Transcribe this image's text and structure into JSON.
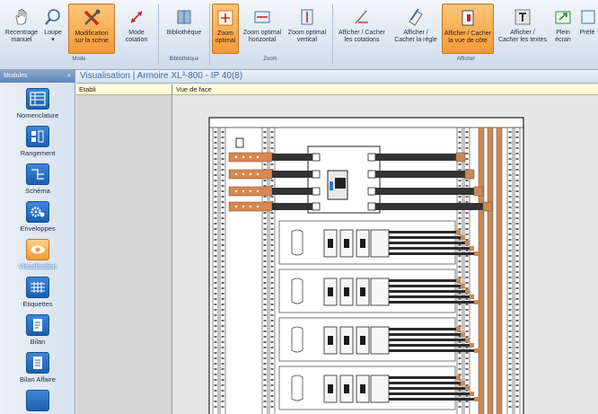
{
  "ribbon": {
    "buttons": [
      {
        "label1": "Recentrage",
        "label2": "manuel",
        "icon": "hand-icon",
        "active": false
      },
      {
        "label1": "Loupe",
        "label2": "▾",
        "icon": "magnifier-icon",
        "active": false
      },
      {
        "label1": "Modification",
        "label2": "sur la scène",
        "icon": "tools-icon",
        "active": true
      },
      {
        "label1": "Mode",
        "label2": "cotation",
        "icon": "dimension-icon",
        "active": false
      },
      {
        "label1": "Bibliothèque",
        "label2": "",
        "icon": "library-icon",
        "active": false
      },
      {
        "label1": "Zoom",
        "label2": "optimal",
        "icon": "zoom-optimal-icon",
        "active": true
      },
      {
        "label1": "Zoom optimal",
        "label2": "horizontal",
        "icon": "zoom-horizontal-icon",
        "active": false
      },
      {
        "label1": "Zoom optimal",
        "label2": "vertical",
        "icon": "zoom-vertical-icon",
        "active": false
      },
      {
        "label1": "Afficher / Cacher",
        "label2": "les cotations",
        "icon": "ruler-icon",
        "active": false
      },
      {
        "label1": "Afficher /",
        "label2": "Cacher la règle",
        "icon": "rule-icon",
        "active": false
      },
      {
        "label1": "Afficher / Cacher",
        "label2": "la vue de côté",
        "icon": "side-view-icon",
        "active": true
      },
      {
        "label1": "Afficher /",
        "label2": "Cacher les textes",
        "icon": "text-icon",
        "active": false
      },
      {
        "label1": "Plein",
        "label2": "écran",
        "icon": "fullscreen-icon",
        "active": false
      },
      {
        "label1": "Préfé",
        "label2": "",
        "icon": "preferences-icon",
        "active": false
      }
    ],
    "groups": {
      "mode": "Mode",
      "bibliotheque": "Bibliothèque",
      "zoom": "Zoom",
      "afficher": "Afficher"
    }
  },
  "sidebar": {
    "title": "Modules",
    "collapse": "«",
    "items": [
      {
        "label": "Nomenclature",
        "icon": "nomenclature-icon",
        "active": false
      },
      {
        "label": "Rangement",
        "icon": "rangement-icon",
        "active": false
      },
      {
        "label": "Schéma",
        "icon": "schema-icon",
        "active": false
      },
      {
        "label": "Enveloppes",
        "icon": "gears-icon",
        "active": false
      },
      {
        "label": "Visualisation",
        "icon": "eye-icon",
        "active": true
      },
      {
        "label": "Etiquettes",
        "icon": "labels-icon",
        "active": false
      },
      {
        "label": "Bilan",
        "icon": "report-icon",
        "active": false
      },
      {
        "label": "Bilan Affaire",
        "icon": "report-project-icon",
        "active": false
      }
    ]
  },
  "main": {
    "title": "Visualisation | Armoire XL³-800 - IP 40(8)",
    "etabli_label": "Etabli",
    "vue_label": "Vue de face"
  },
  "colors": {
    "accent": "#f39a38",
    "brand": "#1c5fae",
    "title": "#3e68a8",
    "copper": "#c8895a"
  }
}
